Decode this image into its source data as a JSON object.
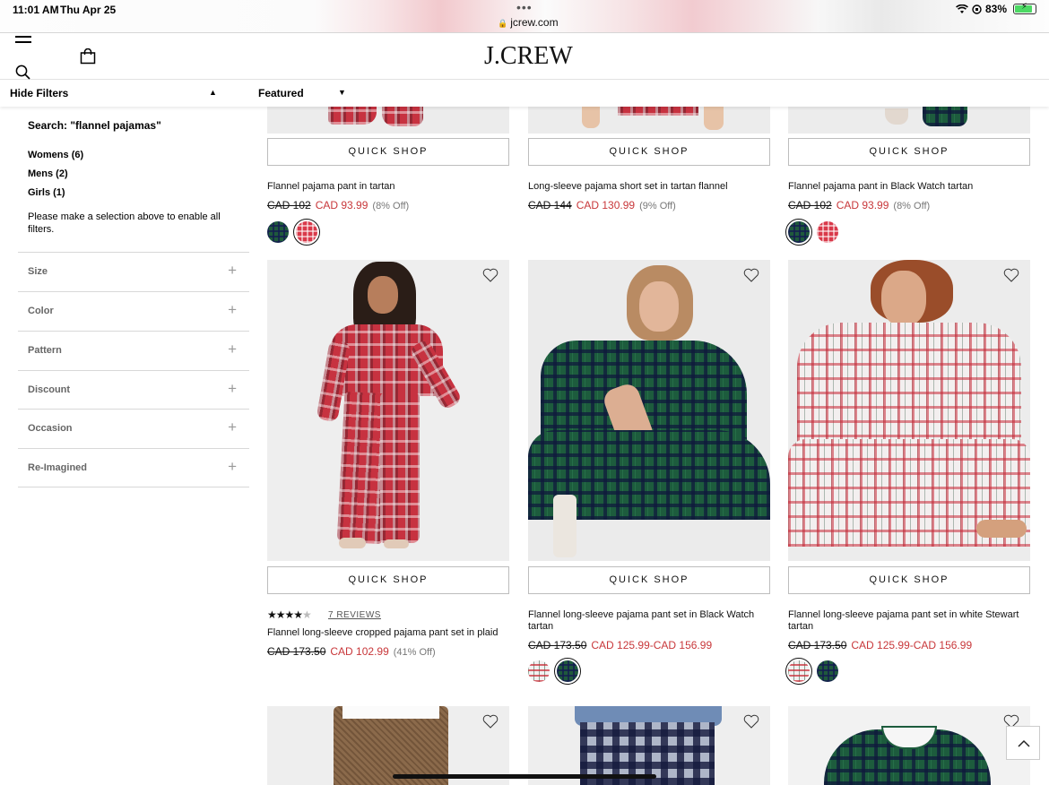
{
  "status_bar": {
    "time": "11:01 AM",
    "date": "Thu Apr 25",
    "url": "jcrew.com",
    "battery": "83%",
    "dots": "•••"
  },
  "header": {
    "logo": "J.CREW",
    "icons": [
      "hamburger-menu-icon",
      "search-icon",
      "shopping-bag-icon"
    ]
  },
  "toolbar": {
    "hide_filters": "Hide Filters",
    "sort": "Featured"
  },
  "sidebar": {
    "search_label": "Search: \"flannel pajamas\"",
    "categories": [
      "Womens (6)",
      "Mens (2)",
      "Girls (1)"
    ],
    "note": "Please make a selection above to enable all filters.",
    "facets": [
      "Size",
      "Color",
      "Pattern",
      "Discount",
      "Occasion",
      "Re-Imagined"
    ]
  },
  "products": {
    "quick_shop": "QUICK SHOP",
    "row1": [
      {
        "name": "Flannel pajama pant in tartan",
        "was": "CAD 102",
        "now": "CAD 93.99",
        "off": "(8% Off)"
      },
      {
        "name": "Long-sleeve pajama short set in tartan flannel",
        "was": "CAD 144",
        "now": "CAD 130.99",
        "off": "(9% Off)"
      },
      {
        "name": "Flannel pajama pant in Black Watch tartan",
        "was": "CAD 102",
        "now": "CAD 93.99",
        "off": "(8% Off)"
      }
    ],
    "row2": [
      {
        "name": "Flannel long-sleeve cropped pajama pant set in plaid",
        "was": "CAD 173.50",
        "now": "CAD 102.99",
        "off": "(41% Off)",
        "rating": 4,
        "reviews": "7 REVIEWS"
      },
      {
        "name": "Flannel long-sleeve pajama pant set in Black Watch tartan",
        "was": "CAD 173.50",
        "now": "CAD 125.99-CAD 156.99"
      },
      {
        "name": "Flannel long-sleeve pajama pant set in white Stewart tartan",
        "was": "CAD 173.50",
        "now": "CAD 125.99-CAD 156.99"
      }
    ]
  },
  "colors": {
    "sale_red": "#c8373a",
    "text": "#111111"
  }
}
